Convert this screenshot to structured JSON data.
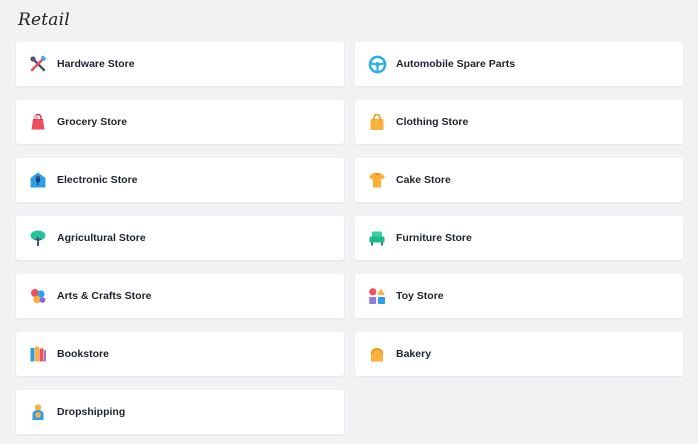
{
  "section": {
    "title": "Retail"
  },
  "stores": [
    {
      "label": "Hardware Store",
      "icon": "tools-icon"
    },
    {
      "label": "Automobile Spare Parts",
      "icon": "steering-wheel-icon"
    },
    {
      "label": "Grocery Store",
      "icon": "grocery-bag-icon"
    },
    {
      "label": "Clothing Store",
      "icon": "shopping-bag-icon"
    },
    {
      "label": "Electronic Store",
      "icon": "plug-house-icon"
    },
    {
      "label": "Cake Store",
      "icon": "shirt-icon"
    },
    {
      "label": "Agricultural Store",
      "icon": "tree-icon"
    },
    {
      "label": "Furniture Store",
      "icon": "armchair-icon"
    },
    {
      "label": "Arts & Crafts Store",
      "icon": "palette-icon"
    },
    {
      "label": "Toy Store",
      "icon": "toy-blocks-icon"
    },
    {
      "label": "Bookstore",
      "icon": "books-icon"
    },
    {
      "label": "Bakery",
      "icon": "bread-icon"
    },
    {
      "label": "Dropshipping",
      "icon": "delivery-person-icon"
    }
  ]
}
